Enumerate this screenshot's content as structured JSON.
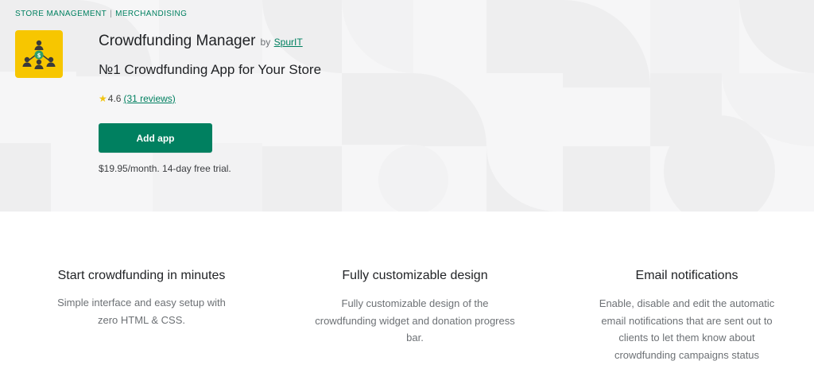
{
  "breadcrumb": {
    "category": "STORE MANAGEMENT",
    "separator": "|",
    "subcategory": "MERCHANDISING"
  },
  "app": {
    "icon": "people-money-icon",
    "icon_bg_color": "#f7c600",
    "title": "Crowdfunding Manager",
    "by_label": "by",
    "developer": "SpurIT",
    "tagline": "№1 Crowdfunding App for Your Store",
    "rating": "4.6",
    "reviews": "(31 reviews)",
    "add_button_label": "Add app",
    "pricing": "$19.95/month. 14-day free trial."
  },
  "features": [
    {
      "title": "Start crowdfunding in minutes",
      "description": "Simple interface and easy setup with zero HTML & CSS."
    },
    {
      "title": "Fully customizable design",
      "description": "Fully customizable design of the crowdfunding widget and donation progress bar."
    },
    {
      "title": "Email notifications",
      "description": "Enable, disable and edit the automatic email notifications that are sent out to clients to let them know about crowdfunding campaigns status"
    }
  ],
  "colors": {
    "accent": "#008060",
    "hero_bg": "#f6f6f7",
    "star": "#f1c40f"
  }
}
